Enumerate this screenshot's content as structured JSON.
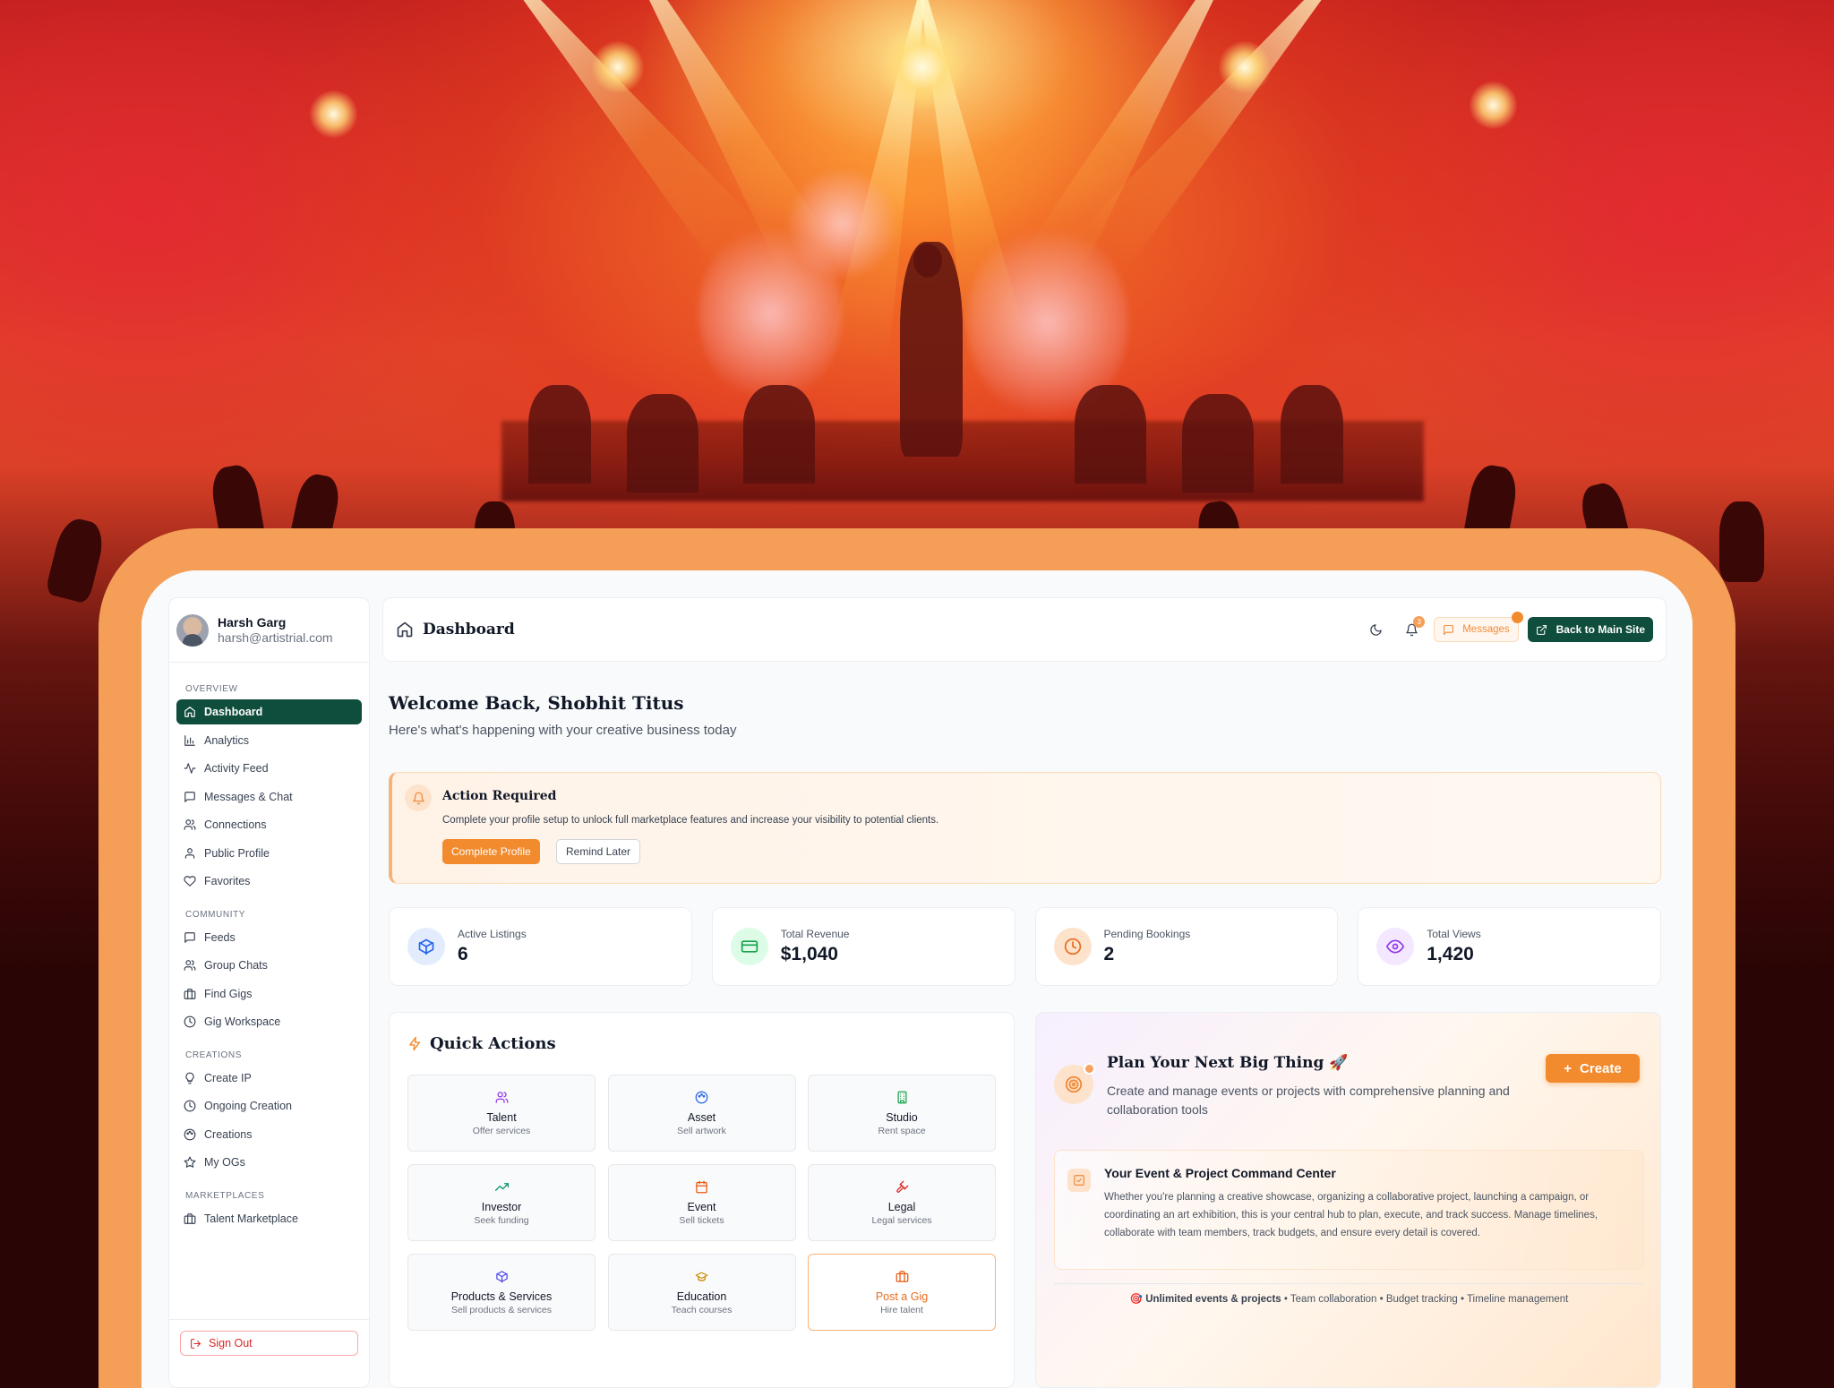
{
  "sidebar": {
    "user_name": "Harsh Garg",
    "user_email": "harsh@artistrial.com",
    "sections": [
      {
        "title": "OVERVIEW",
        "items": [
          {
            "label": "Dashboard",
            "icon": "home-icon",
            "active": true
          },
          {
            "label": "Analytics",
            "icon": "bar-chart-icon"
          },
          {
            "label": "Activity Feed",
            "icon": "activity-icon"
          },
          {
            "label": "Messages & Chat",
            "icon": "message-icon"
          },
          {
            "label": "Connections",
            "icon": "users-icon"
          },
          {
            "label": "Public Profile",
            "icon": "user-icon"
          },
          {
            "label": "Favorites",
            "icon": "heart-icon"
          }
        ]
      },
      {
        "title": "COMMUNITY",
        "items": [
          {
            "label": "Feeds",
            "icon": "message-icon"
          },
          {
            "label": "Group Chats",
            "icon": "users-icon"
          },
          {
            "label": "Find Gigs",
            "icon": "briefcase-icon"
          },
          {
            "label": "Gig Workspace",
            "icon": "clock-icon"
          }
        ]
      },
      {
        "title": "CREATIONS",
        "items": [
          {
            "label": "Create IP",
            "icon": "bulb-icon"
          },
          {
            "label": "Ongoing Creation",
            "icon": "clock-icon"
          },
          {
            "label": "Creations",
            "icon": "palette-icon"
          },
          {
            "label": "My OGs",
            "icon": "star-icon"
          }
        ]
      },
      {
        "title": "MARKETPLACES",
        "items": [
          {
            "label": "Talent Marketplace",
            "icon": "briefcase-icon"
          }
        ]
      }
    ],
    "sign_out": "Sign Out"
  },
  "topbar": {
    "title": "Dashboard",
    "notification_count": "3",
    "messages_label": "Messages",
    "back_label": "Back to Main Site"
  },
  "welcome": {
    "title": "Welcome Back, Shobhit Titus",
    "subtitle": "Here's what's happening with your creative business today"
  },
  "action_required": {
    "title": "Action Required",
    "message": "Complete your profile setup to unlock full marketplace features and increase your visibility to potential clients.",
    "primary": "Complete Profile",
    "secondary": "Remind Later"
  },
  "stats": [
    {
      "label": "Active Listings",
      "value": "6",
      "icon": "box-icon",
      "bg": "#e3ecfd",
      "color": "#2563eb"
    },
    {
      "label": "Total Revenue",
      "value": "$1,040",
      "icon": "credit-card-icon",
      "bg": "#dcfce7",
      "color": "#16a34a"
    },
    {
      "label": "Pending Bookings",
      "value": "2",
      "icon": "clock-icon",
      "bg": "#fde3cb",
      "color": "#ea6b1f"
    },
    {
      "label": "Total Views",
      "value": "1,420",
      "icon": "eye-icon",
      "bg": "#f3e8ff",
      "color": "#9333ea"
    }
  ],
  "quick_actions": {
    "title": "Quick Actions",
    "tiles": [
      {
        "title": "Talent",
        "sub": "Offer services",
        "icon": "users-icon",
        "color": "#9333ea"
      },
      {
        "title": "Asset",
        "sub": "Sell artwork",
        "icon": "palette-icon",
        "color": "#2563eb"
      },
      {
        "title": "Studio",
        "sub": "Rent space",
        "icon": "building-icon",
        "color": "#16a34a"
      },
      {
        "title": "Investor",
        "sub": "Seek funding",
        "icon": "trending-up-icon",
        "color": "#059669"
      },
      {
        "title": "Event",
        "sub": "Sell tickets",
        "icon": "calendar-icon",
        "color": "#ea580c"
      },
      {
        "title": "Legal",
        "sub": "Legal services",
        "icon": "gavel-icon",
        "color": "#dc2626"
      },
      {
        "title": "Products & Services",
        "sub": "Sell products & services",
        "icon": "box-icon",
        "color": "#4f46e5"
      },
      {
        "title": "Education",
        "sub": "Teach courses",
        "icon": "graduation-cap-icon",
        "color": "#ca8a04"
      },
      {
        "title": "Post a Gig",
        "sub": "Hire talent",
        "icon": "briefcase-icon",
        "color": "#ea580c",
        "highlight": true
      }
    ]
  },
  "plan": {
    "title": "Plan Your Next Big Thing 🚀",
    "description": "Create and manage events or projects with comprehensive planning and collaboration tools",
    "create_label": "Create",
    "command_title": "Your Event & Project Command Center",
    "command_text": "Whether you're planning a creative showcase, organizing a collaborative project, launching a campaign, or coordinating an art exhibition, this is your central hub to plan, execute, and track success. Manage timelines, collaborate with team members, track budgets, and ensure every detail is covered.",
    "footer_bold": "Unlimited events & projects",
    "footer_rest": " • Team collaboration • Budget tracking • Timeline management"
  }
}
